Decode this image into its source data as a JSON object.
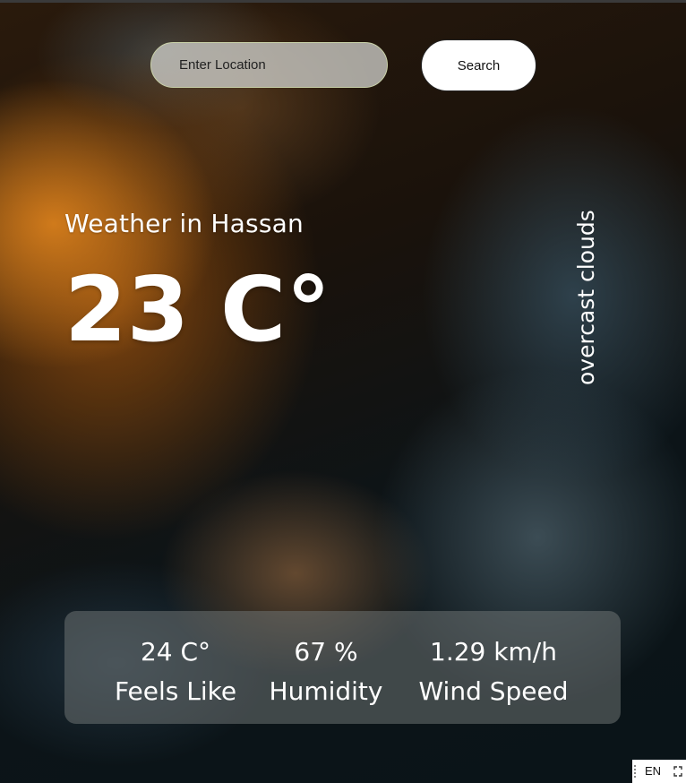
{
  "search": {
    "placeholder": "Enter Location",
    "button_label": "Search"
  },
  "weather": {
    "title": "Weather in Hassan",
    "temperature": "23 C°",
    "description": "overcast clouds"
  },
  "stats": {
    "feels_like": {
      "value": "24 C°",
      "label": "Feels Like"
    },
    "humidity": {
      "value": "67 %",
      "label": "Humidity"
    },
    "wind_speed": {
      "value": "1.29 km/h",
      "label": "Wind Speed"
    }
  },
  "language_indicator": {
    "label": "EN",
    "icon": "expand-icon"
  }
}
